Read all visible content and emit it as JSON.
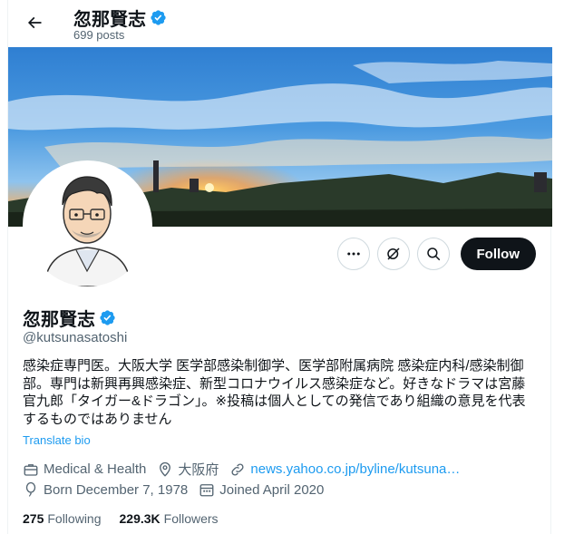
{
  "header": {
    "name": "忽那賢志",
    "posts": "699 posts"
  },
  "profile": {
    "name": "忽那賢志",
    "handle": "@kutsunasatoshi",
    "bio_lines": [
      "感染症専門医。大阪大学 医学部感染制御学、医学部附属病院 感染症内科/感染制御",
      "部。専門は新興再興感染症、新型コロナウイルス感染症など。好きなドラマは宮藤",
      "官九郎「タイガー&ドラゴン」。※投稿は個人としての発信であり組織の意見を代表",
      "するものではありません"
    ],
    "translate_label": "Translate bio",
    "category": "Medical & Health",
    "location": "大阪府",
    "website": "news.yahoo.co.jp/byline/kutsuna…",
    "born": "Born December 7, 1978",
    "joined": "Joined April 2020",
    "following_count": "275",
    "following_label": "Following",
    "followers_count": "229.3K",
    "followers_label": "Followers"
  },
  "actions": {
    "follow_label": "Follow"
  },
  "icons": {
    "back": "arrow-left-icon",
    "verified": "verified-badge-icon",
    "more": "more-icon",
    "grok": "grok-icon",
    "search": "search-icon",
    "category": "briefcase-icon",
    "location": "location-icon",
    "link": "link-icon",
    "born": "balloon-icon",
    "joined": "calendar-icon"
  },
  "colors": {
    "accent": "#1d9bf0",
    "text": "#0f1419",
    "muted": "#536471",
    "follow_bg": "#0f1419"
  }
}
